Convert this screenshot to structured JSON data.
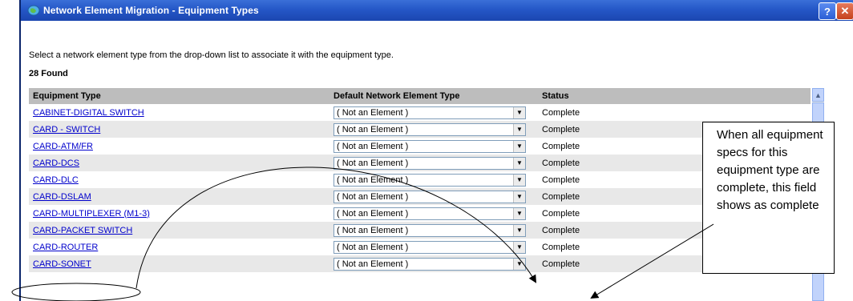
{
  "window": {
    "title": "Network Element Migration - Equipment Types",
    "help_label": "?",
    "close_label": "✕"
  },
  "instruction": "Select a network element type from the drop-down list to associate it with the equipment type.",
  "found_count": "28 Found",
  "table": {
    "columns": [
      "Equipment Type",
      "Default Network Element Type",
      "Status"
    ],
    "rows": [
      {
        "equipment": "CABINET-DIGITAL SWITCH",
        "element": "( Not an Element )",
        "status": "Complete"
      },
      {
        "equipment": "CARD - SWITCH",
        "element": "( Not an Element )",
        "status": "Complete"
      },
      {
        "equipment": "CARD-ATM/FR",
        "element": "( Not an Element )",
        "status": "Complete"
      },
      {
        "equipment": "CARD-DCS",
        "element": "( Not an Element )",
        "status": "Complete"
      },
      {
        "equipment": "CARD-DLC",
        "element": "( Not an Element )",
        "status": "Complete"
      },
      {
        "equipment": "CARD-DSLAM",
        "element": "( Not an Element )",
        "status": "Complete"
      },
      {
        "equipment": "CARD-MULTIPLEXER (M1-3)",
        "element": "( Not an Element )",
        "status": "Complete"
      },
      {
        "equipment": "CARD-PACKET SWITCH",
        "element": "( Not an Element )",
        "status": "Complete"
      },
      {
        "equipment": "CARD-ROUTER",
        "element": "( Not an Element )",
        "status": "Complete"
      },
      {
        "equipment": "CARD-SONET",
        "element": "( Not an Element )",
        "status": "Complete"
      }
    ]
  },
  "callout": {
    "lines": [
      "When all equipment",
      "specs for this",
      "equipment type are",
      "complete, this field",
      "shows as complete"
    ]
  },
  "colors": {
    "titlebar": "#2557c7",
    "header_bg": "#bdbdbd",
    "alt_row_bg": "#e8e8e8",
    "link": "#0000cc"
  }
}
